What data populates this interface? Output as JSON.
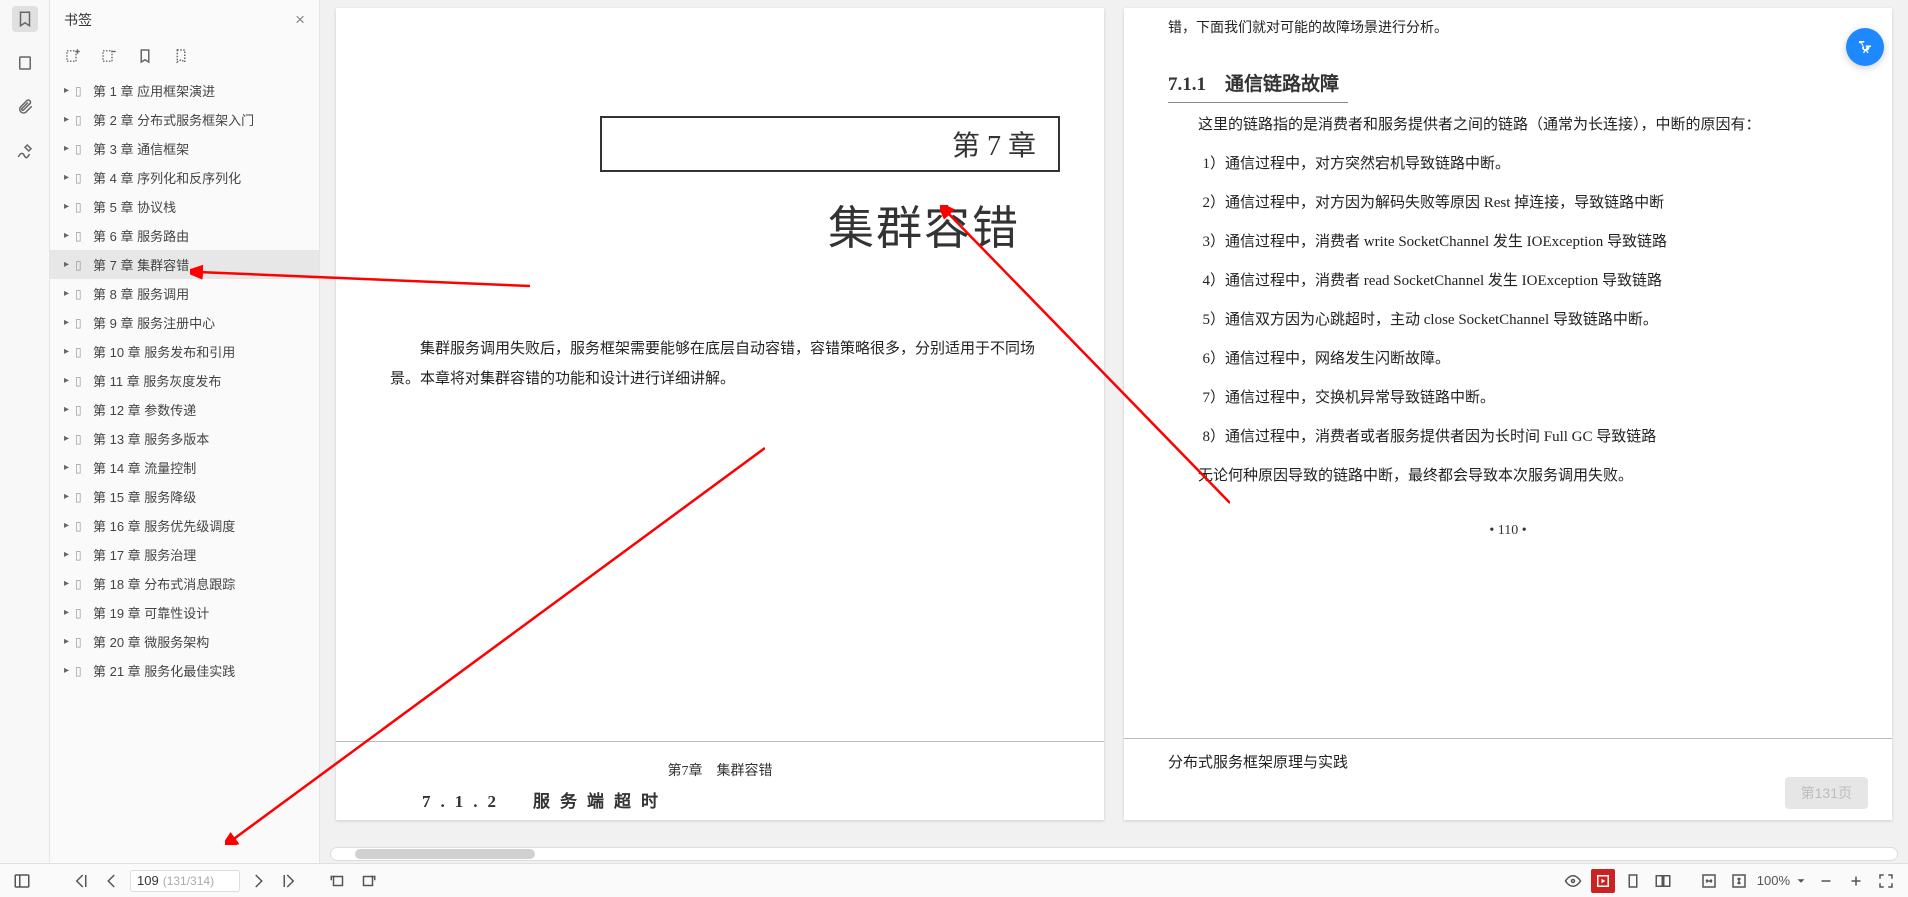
{
  "sidebar": {
    "title": "书签",
    "items": [
      {
        "label": "第 1 章 应用框架演进"
      },
      {
        "label": "第 2 章 分布式服务框架入门"
      },
      {
        "label": "第 3 章 通信框架"
      },
      {
        "label": "第 4 章 序列化和反序列化"
      },
      {
        "label": "第 5 章 协议栈"
      },
      {
        "label": "第 6 章 服务路由"
      },
      {
        "label": "第 7 章 集群容错",
        "selected": true
      },
      {
        "label": "第 8 章 服务调用"
      },
      {
        "label": "第 9 章 服务注册中心"
      },
      {
        "label": "第 10 章 服务发布和引用"
      },
      {
        "label": "第 11 章 服务灰度发布"
      },
      {
        "label": "第 12 章 参数传递"
      },
      {
        "label": "第 13 章 服务多版本"
      },
      {
        "label": "第 14 章 流量控制"
      },
      {
        "label": "第 15 章 服务降级"
      },
      {
        "label": "第 16 章 服务优先级调度"
      },
      {
        "label": "第 17 章 服务治理"
      },
      {
        "label": "第 18 章 分布式消息跟踪"
      },
      {
        "label": "第 19 章 可靠性设计"
      },
      {
        "label": "第 20 章 微服务架构"
      },
      {
        "label": "第 21 章 服务化最佳实践"
      }
    ]
  },
  "page_left": {
    "chapter_box": "第 7 章",
    "chapter_title": "集群容错",
    "intro": "集群服务调用失败后，服务框架需要能够在底层自动容错，容错策略很多，分别适用于不同场景。本章将对集群容错的功能和设计进行详细讲解。",
    "footer_hd": "第7章　集群容错",
    "sec712": "7.1.2　服务端超时"
  },
  "page_right": {
    "top_trail": "错，下面我们就对可能的故障场景进行分析。",
    "h2": "7.1.1　通信链路故障",
    "p1": "这里的链路指的是消费者和服务提供者之间的链路（通常为长连接），中断的原因有：",
    "li1": "1）通信过程中，对方突然宕机导致链路中断。",
    "li2": "2）通信过程中，对方因为解码失败等原因 Rest 掉连接，导致链路中断",
    "li3": "3）通信过程中，消费者 write SocketChannel 发生 IOException 导致链路",
    "li4": "4）通信过程中，消费者 read SocketChannel 发生 IOException 导致链路",
    "li5": "5）通信双方因为心跳超时，主动 close SocketChannel 导致链路中断。",
    "li6": "6）通信过程中，网络发生闪断故障。",
    "li7": "7）通信过程中，交换机异常导致链路中断。",
    "li8": "8）通信过程中，消费者或者服务提供者因为长时间 Full GC 导致链路",
    "p2": "无论何种原因导致的链路中断，最终都会导致本次服务调用失败。",
    "pgnum": "• 110 •",
    "footer_hd": "分布式服务框架原理与实践"
  },
  "status": {
    "page_current": "109",
    "page_total": "(131/314)",
    "zoom": "100%"
  },
  "ghost_btn": "第131页"
}
